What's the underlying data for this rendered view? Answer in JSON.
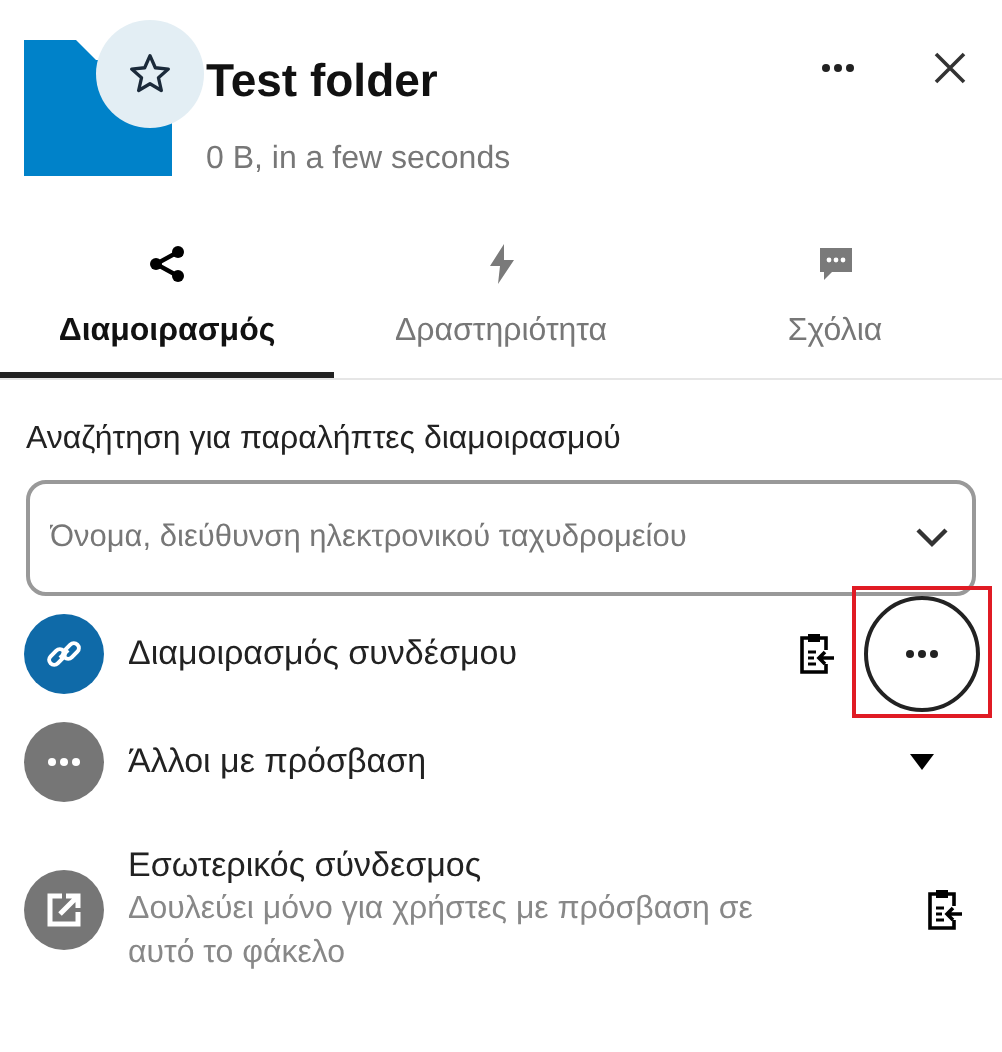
{
  "header": {
    "title": "Test folder",
    "subtitle": "0 B, in a few seconds",
    "favorite": false
  },
  "tabs": [
    {
      "label": "Διαμοιρασμός",
      "selected": true
    },
    {
      "label": "Δραστηριότητα",
      "selected": false
    },
    {
      "label": "Σχόλια",
      "selected": false
    }
  ],
  "search": {
    "label": "Αναζήτηση για παραλήπτες διαμοιρασμού",
    "placeholder": "Όνομα, διεύθυνση ηλεκτρονικού ταχυδρομείου"
  },
  "entries": [
    {
      "kind": "link",
      "title": "Διαμοιρασμός συνδέσμου",
      "highlighted": true
    },
    {
      "kind": "others",
      "title": "Άλλοι με πρόσβαση",
      "expanded": false
    },
    {
      "kind": "internal",
      "title": "Εσωτερικός σύνδεσμος",
      "subtitle": "Δουλεύει μόνο για χρήστες με πρόσβαση σε αυτό το φάκελο"
    }
  ]
}
